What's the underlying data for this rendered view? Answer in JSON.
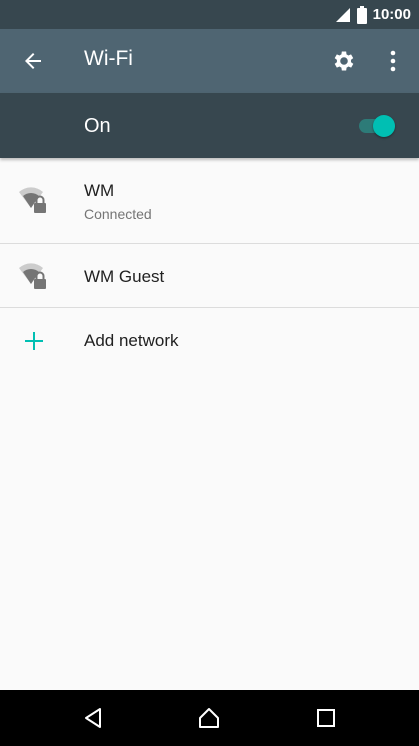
{
  "status_bar": {
    "time": "10:00",
    "icons": [
      "signal-icon",
      "battery-icon"
    ]
  },
  "toolbar": {
    "title": "Wi-Fi",
    "icons": [
      "back-arrow-icon",
      "gear-icon",
      "more-vert-icon"
    ]
  },
  "master_switch": {
    "label": "On",
    "checked": true,
    "accent_color": "#00bfb3"
  },
  "networks": [
    {
      "name": "WM",
      "status": "Connected",
      "icon": "wifi-lock-icon"
    },
    {
      "name": "WM Guest",
      "icon": "wifi-lock-icon"
    }
  ],
  "add_network": {
    "label": "Add network",
    "icon": "plus-icon"
  },
  "nav_bar": {
    "icons": [
      "back-icon",
      "home-icon",
      "recents-icon"
    ]
  },
  "colors": {
    "status_bar": "#37474f",
    "toolbar": "#4f6572",
    "switch_bar": "#37474f",
    "accent": "#00bfb3",
    "background": "#fafafa"
  }
}
